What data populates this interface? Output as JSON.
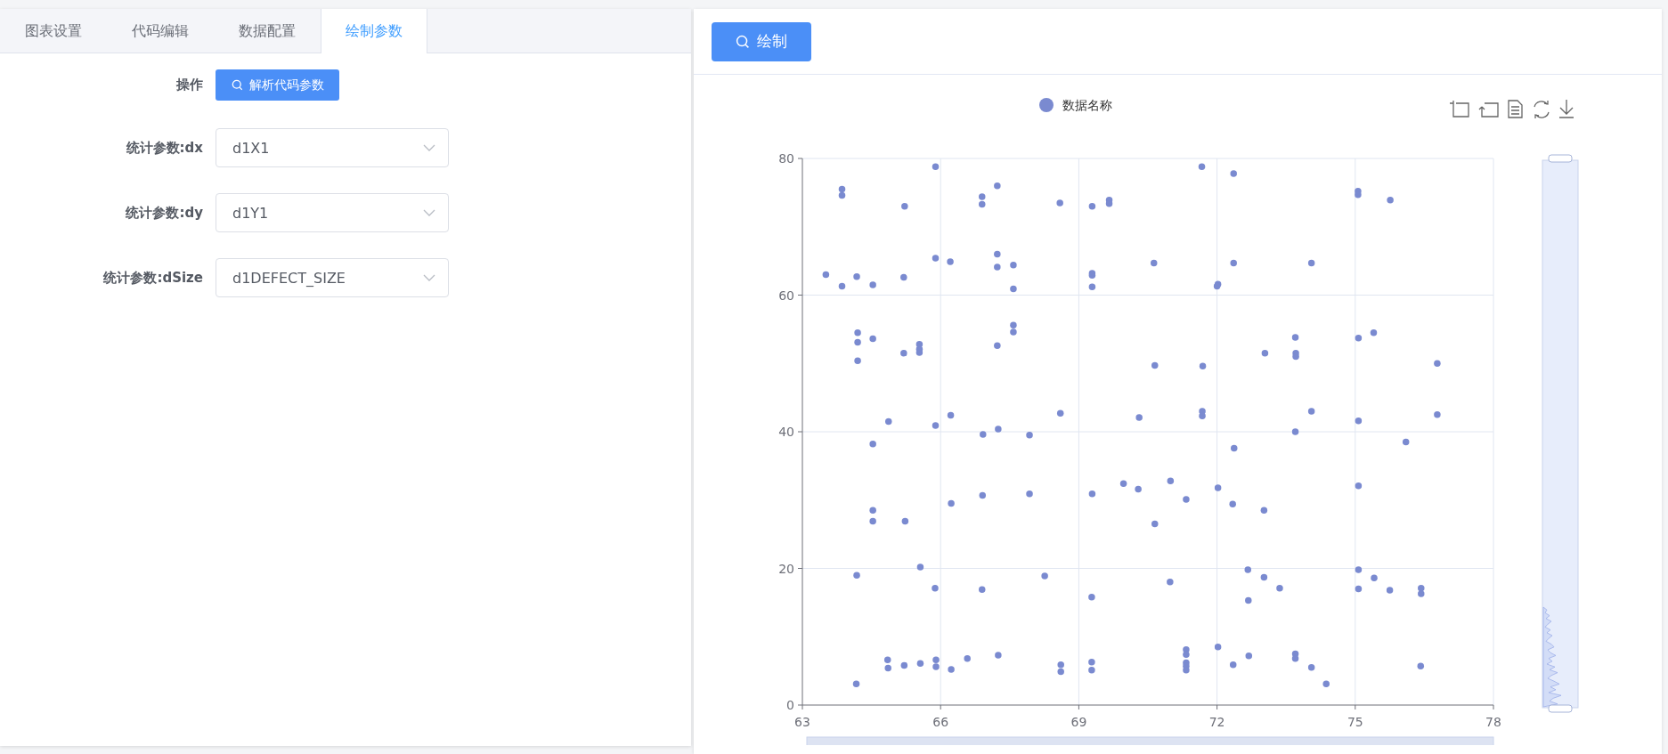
{
  "tabs": [
    {
      "label": "图表设置",
      "selected": false
    },
    {
      "label": "代码编辑",
      "selected": false
    },
    {
      "label": "数据配置",
      "selected": false
    },
    {
      "label": "绘制参数",
      "selected": true
    }
  ],
  "form": [
    {
      "kind": "button",
      "label": "操作",
      "button": "解析代码参数"
    },
    {
      "kind": "select",
      "label": "统计参数:dx",
      "value": "d1X1"
    },
    {
      "kind": "select",
      "label": "统计参数:dy",
      "value": "d1Y1"
    },
    {
      "kind": "select",
      "label": "统计参数:dSize",
      "value": "d1DEFECT_SIZE"
    }
  ],
  "draw_button": "绘制",
  "chart_data": {
    "type": "scatter",
    "xlim": [
      63,
      78
    ],
    "ylim": [
      0,
      80
    ],
    "xticks": [
      63,
      66,
      69,
      72,
      75,
      78
    ],
    "yticks": [
      0,
      20,
      40,
      60,
      80
    ],
    "x": [
      63.86,
      63.86,
      65.22,
      65.89,
      66.9,
      66.9,
      67.23,
      68.59,
      69.29,
      69.66,
      69.66,
      71.67,
      72.36,
      75.06,
      75.06,
      75.76,
      63.51,
      63.86,
      64.18,
      64.53,
      65.2,
      65.89,
      66.21,
      67.23,
      67.23,
      67.58,
      67.58,
      69.29,
      69.29,
      69.29,
      70.63,
      72.02,
      72.0,
      72.36,
      74.05,
      64.2,
      64.2,
      64.53,
      64.2,
      65.2,
      65.54,
      65.54,
      65.54,
      67.23,
      67.58,
      67.58,
      73.7,
      75.4,
      75.07,
      73.04,
      73.71,
      73.71,
      71.69,
      70.65,
      76.78,
      70.31,
      71.68,
      71.68,
      74.05,
      75.07,
      76.78,
      73.7,
      64.87,
      65.89,
      66.22,
      66.92,
      67.25,
      67.93,
      68.6,
      64.53,
      69.97,
      70.29,
      66.91,
      67.93,
      69.29,
      66.23,
      64.53,
      64.53,
      65.23,
      70.99,
      71.33,
      72.02,
      72.34,
      73.02,
      70.65,
      72.37,
      76.1,
      75.07,
      65.56,
      64.18,
      65.88,
      66.9,
      68.26,
      69.28,
      70.98,
      72.67,
      73.02,
      73.36,
      72.68,
      75.07,
      75.41,
      75.07,
      75.75,
      76.43,
      76.43,
      67.25,
      64.17,
      64.85,
      64.86,
      65.21,
      65.56,
      65.9,
      65.9,
      66.23,
      66.58,
      68.61,
      68.61,
      69.28,
      69.28,
      72.02,
      71.33,
      71.33,
      71.33,
      71.33,
      71.33,
      72.35,
      72.69,
      73.7,
      73.7,
      74.05,
      74.37,
      76.42
    ],
    "series": [
      {
        "name": "数据名称",
        "color": "#7a8ad0",
        "values": [
          75.5,
          74.6,
          73.0,
          78.8,
          74.4,
          73.3,
          76.0,
          73.5,
          73.0,
          73.9,
          73.4,
          78.8,
          77.8,
          75.2,
          74.7,
          73.9,
          63.0,
          61.3,
          62.7,
          61.5,
          62.6,
          65.4,
          64.9,
          66.0,
          64.1,
          64.4,
          60.9,
          63.2,
          62.9,
          61.2,
          64.7,
          61.6,
          61.3,
          64.7,
          64.7,
          54.5,
          53.1,
          53.6,
          50.4,
          51.5,
          52.8,
          52.1,
          51.6,
          52.6,
          55.6,
          54.6,
          53.8,
          54.5,
          53.7,
          51.5,
          51.5,
          51.0,
          49.6,
          49.7,
          50.0,
          42.1,
          43.0,
          42.3,
          43.0,
          41.6,
          42.5,
          40.0,
          41.5,
          40.9,
          42.4,
          39.6,
          40.4,
          39.5,
          42.7,
          38.2,
          32.4,
          31.6,
          30.7,
          30.9,
          30.9,
          29.5,
          26.9,
          28.5,
          26.9,
          32.8,
          30.1,
          31.8,
          29.4,
          28.5,
          26.5,
          37.6,
          38.5,
          32.1,
          20.2,
          19.0,
          17.1,
          16.9,
          18.9,
          15.8,
          18.0,
          19.8,
          18.7,
          17.1,
          15.3,
          19.8,
          18.6,
          17.0,
          16.8,
          17.1,
          16.3,
          7.3,
          3.1,
          6.6,
          5.4,
          5.8,
          6.1,
          6.6,
          5.6,
          5.2,
          6.8,
          5.9,
          4.9,
          6.3,
          5.1,
          8.5,
          8.1,
          7.4,
          6.2,
          5.7,
          5.1,
          5.9,
          7.2,
          7.5,
          6.8,
          5.5,
          3.1,
          5.7
        ]
      }
    ],
    "grid": true
  }
}
